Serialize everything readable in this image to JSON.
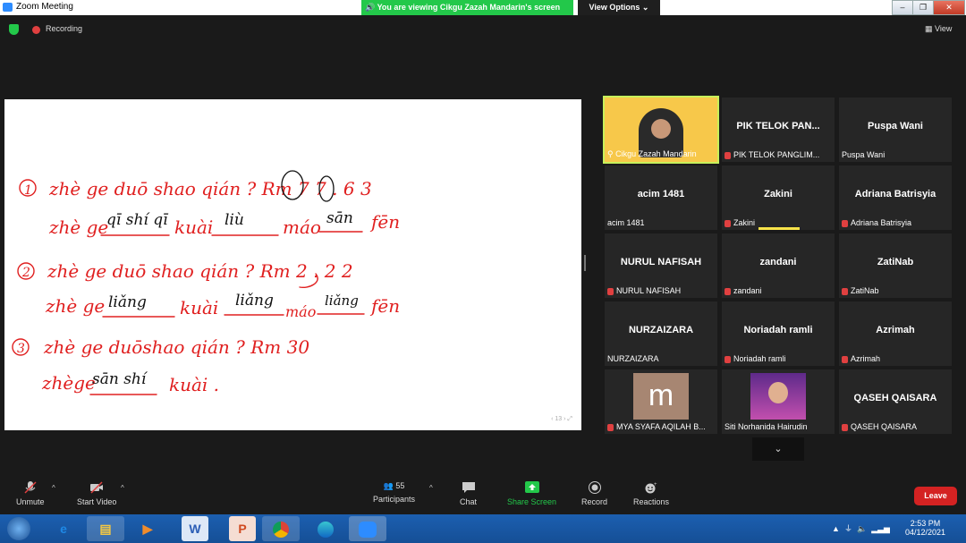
{
  "window": {
    "title": "Zoom Meeting"
  },
  "banner": {
    "viewing": "You are viewing Cikgu Zazah Mandarin's screen",
    "view_options": "View Options"
  },
  "status": {
    "recording": "Recording",
    "view": "View"
  },
  "slide": {
    "lines": [
      {
        "num": "1",
        "red": "zhè ge  duō shao qián ?  Rm 7 7 . 6 3"
      },
      {
        "red_a": "zhè ge",
        "blank1": "qī shí qī",
        "kuai": "kuài",
        "blank2": "liù",
        "mao": "máo",
        "blank3": "sān",
        "fen": "fēn"
      },
      {
        "num": "2",
        "red": "zhè ge  duō shao qián ?  Rm 2 . 2 2"
      },
      {
        "red_a": "zhè ge",
        "blank1": "liǎng",
        "kuai": "kuài",
        "blank2": "liǎng",
        "mao": "máo",
        "blank3": "liǎng",
        "fen": "fēn"
      },
      {
        "num": "3",
        "red": "zhè ge  duōshao qián ?  Rm 30"
      },
      {
        "red_a": "zhège",
        "blank1": "sān shí",
        "kuai": "kuài ."
      }
    ],
    "nav": "‹  13  ›  ⤢"
  },
  "participants": [
    {
      "name": "",
      "label": "Cikgu Zazah Mandarin",
      "muted": false,
      "video": "teacher",
      "active": true
    },
    {
      "name": "PIK TELOK PAN...",
      "label": "PIK TELOK PANGLIM...",
      "muted": true
    },
    {
      "name": "Puspa Wani",
      "label": "Puspa Wani",
      "muted": false
    },
    {
      "name": "acim 1481",
      "label": "acim 1481",
      "muted": false
    },
    {
      "name": "Zakini",
      "label": "Zakini",
      "muted": true,
      "speaking": true
    },
    {
      "name": "Adriana Batrisyia",
      "label": "Adriana Batrisyia",
      "muted": true
    },
    {
      "name": "NURUL NAFISAH",
      "label": "NURUL NAFISAH",
      "muted": true
    },
    {
      "name": "zandani",
      "label": "zandani",
      "muted": true
    },
    {
      "name": "ZatiNab",
      "label": "ZatiNab",
      "muted": true
    },
    {
      "name": "NURZAIZARA",
      "label": "NURZAIZARA",
      "muted": false
    },
    {
      "name": "Noriadah ramli",
      "label": "Noriadah ramli",
      "muted": true
    },
    {
      "name": "Azrimah",
      "label": "Azrimah",
      "muted": true
    },
    {
      "name": "",
      "label": "MYA SYAFA AQILAH B...",
      "muted": true,
      "avatar_letter": "m"
    },
    {
      "name": "",
      "label": "Siti Norhanida Hairudin",
      "muted": false,
      "video": "photo"
    },
    {
      "name": "QASEH QAISARA",
      "label": "QASEH QAISARA",
      "muted": true
    }
  ],
  "toolbar": {
    "unmute": "Unmute",
    "start_video": "Start Video",
    "participants": "Participants",
    "participants_count": "55",
    "chat": "Chat",
    "share": "Share Screen",
    "record": "Record",
    "reactions": "Reactions",
    "leave": "Leave"
  },
  "taskbar": {
    "time": "2:53 PM",
    "date": "04/12/2021"
  },
  "colors": {
    "share_green": "#23c84a",
    "leave_red": "#d42222",
    "ink_red": "#e02020",
    "active_outline": "#c7f05a"
  }
}
